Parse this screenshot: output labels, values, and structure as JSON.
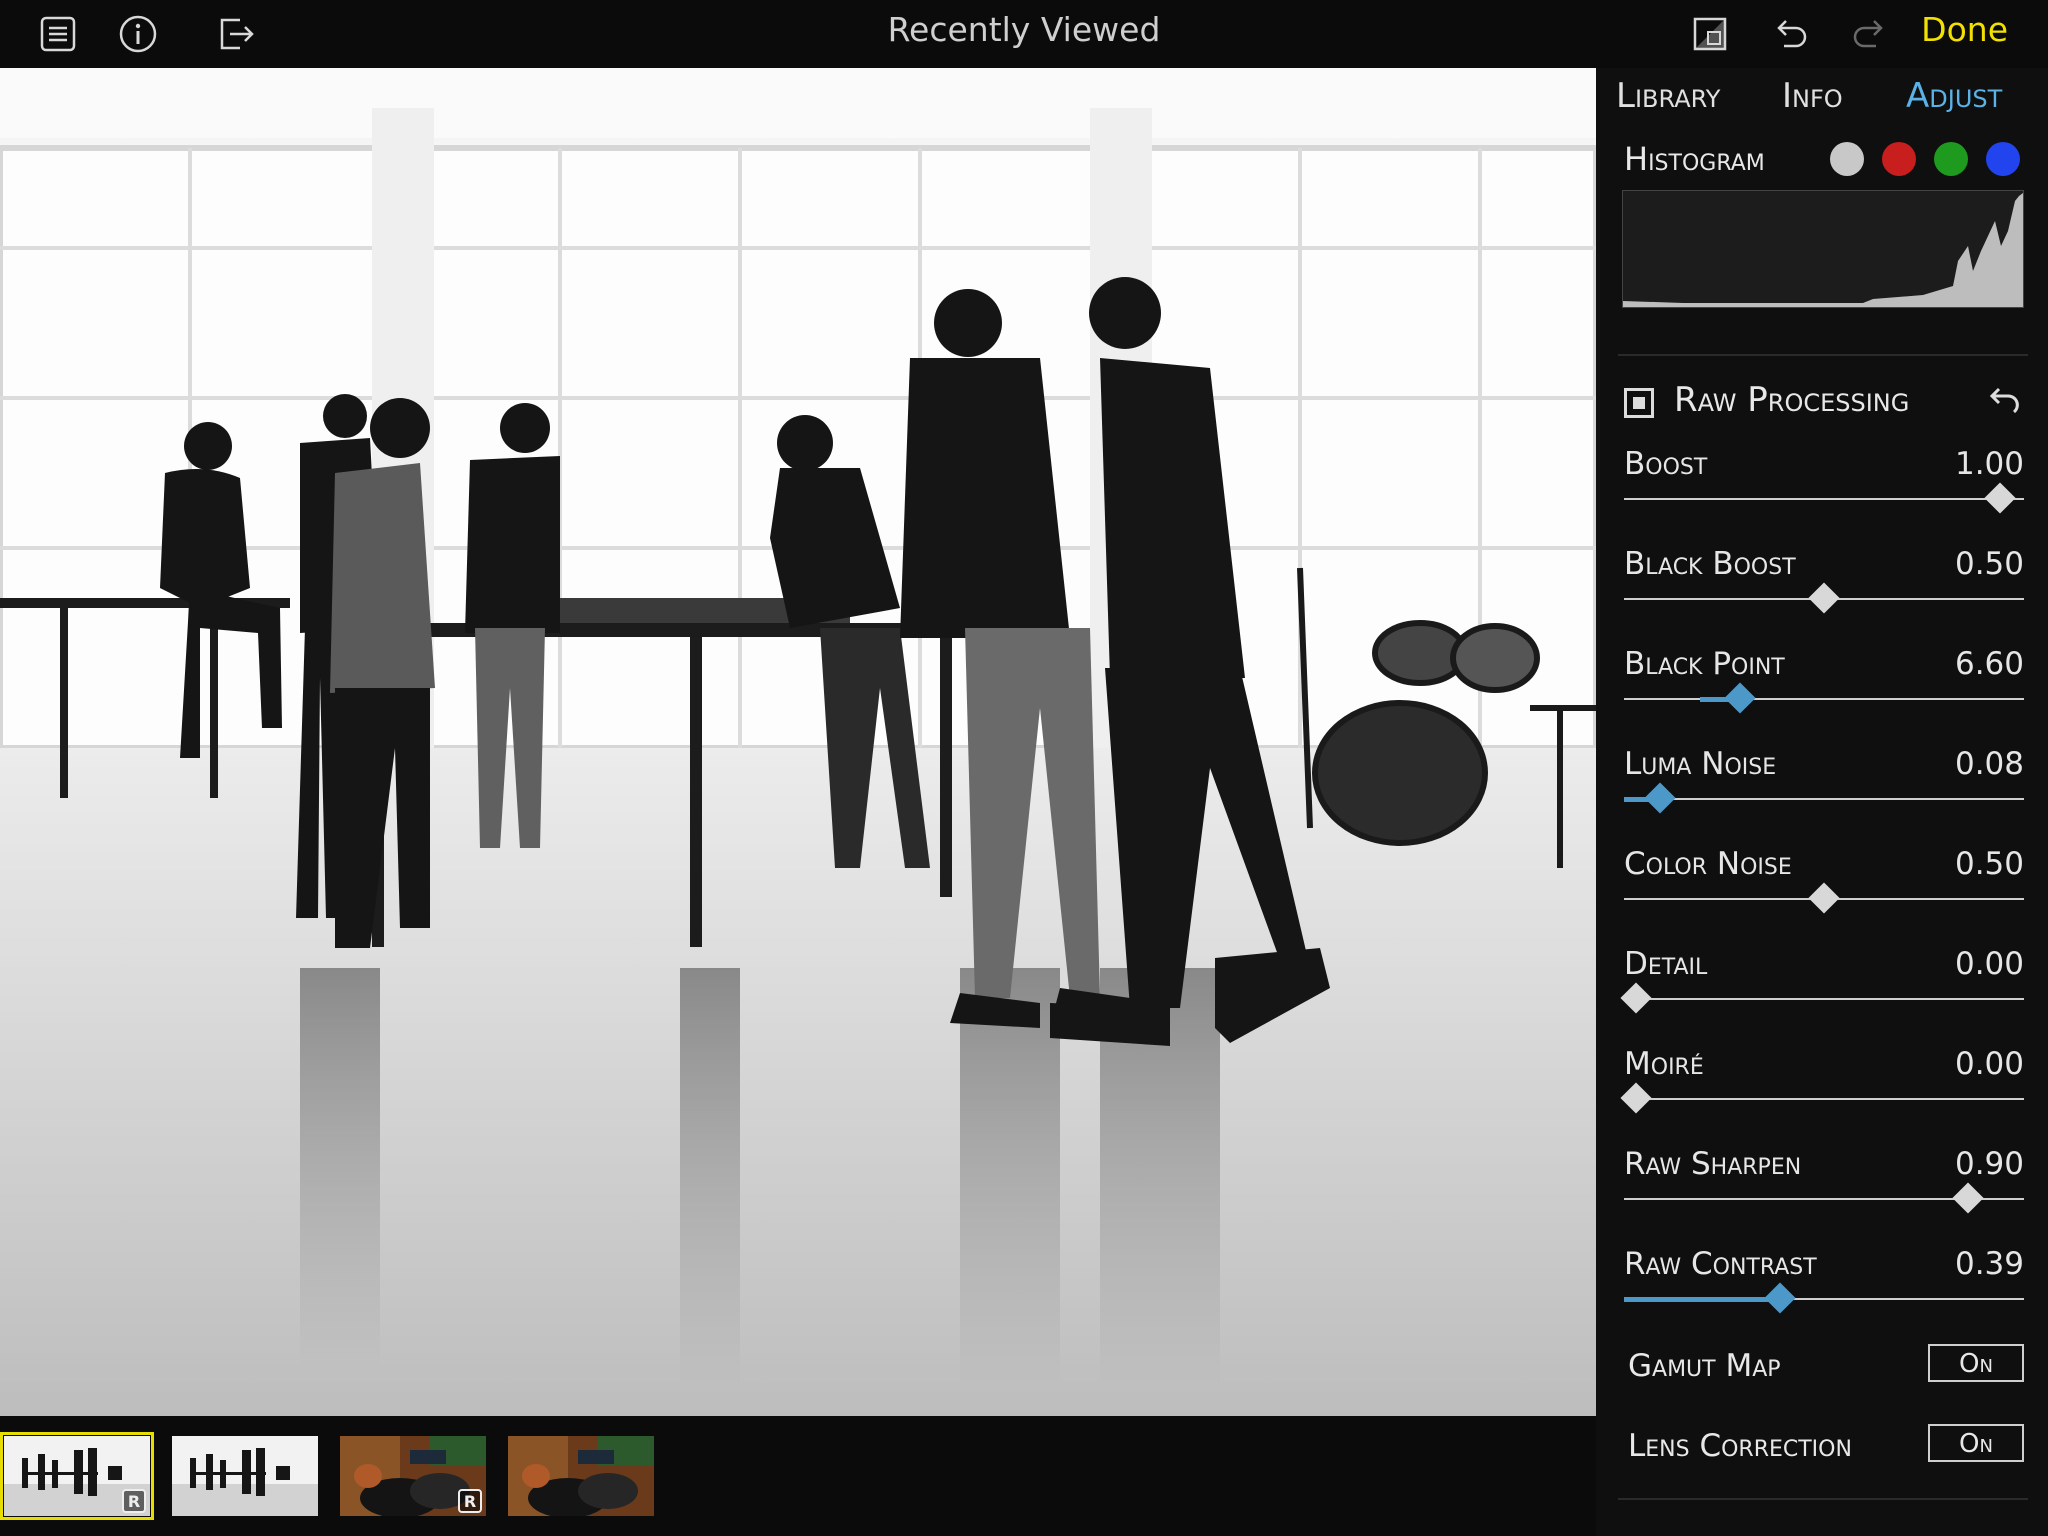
{
  "topbar": {
    "title": "Recently Viewed",
    "done_label": "Done",
    "icons": [
      "list-icon",
      "info-icon",
      "share-export-icon",
      "crop-compare-icon",
      "undo-icon",
      "redo-icon"
    ]
  },
  "panel": {
    "tabs": [
      {
        "label": "Library",
        "active": false
      },
      {
        "label": "Info",
        "active": false
      },
      {
        "label": "Adjust",
        "active": true
      }
    ],
    "histogram": {
      "label": "Histogram",
      "channels": [
        {
          "name": "luminance",
          "color": "#c8c8c8"
        },
        {
          "name": "red",
          "color": "#c81e1e"
        },
        {
          "name": "green",
          "color": "#1e9a1e"
        },
        {
          "name": "blue",
          "color": "#2244ee"
        }
      ]
    },
    "raw_processing": {
      "label": "Raw Processing",
      "enabled": true
    },
    "sliders": [
      {
        "label": "Boost",
        "value": "1.00",
        "fraction": 0.0,
        "thumb": 0.94,
        "fill": false
      },
      {
        "label": "Black Boost",
        "value": "0.50",
        "fraction": 0.0,
        "thumb": 0.5,
        "fill": false
      },
      {
        "label": "Black Point",
        "value": "6.60",
        "fraction": 0.0,
        "thumb": 0.29,
        "fill": true,
        "fill_from": 0.19
      },
      {
        "label": "Luma Noise",
        "value": "0.08",
        "fraction": 0.0,
        "thumb": 0.09,
        "fill": true,
        "fill_from": 0.0
      },
      {
        "label": "Color Noise",
        "value": "0.50",
        "fraction": 0.0,
        "thumb": 0.5,
        "fill": false
      },
      {
        "label": "Detail",
        "value": "0.00",
        "fraction": 0.0,
        "thumb": 0.03,
        "fill": false
      },
      {
        "label": "Moiré",
        "value": "0.00",
        "fraction": 0.0,
        "thumb": 0.03,
        "fill": false
      },
      {
        "label": "Raw Sharpen",
        "value": "0.90",
        "fraction": 0.0,
        "thumb": 0.86,
        "fill": false
      },
      {
        "label": "Raw Contrast",
        "value": "0.39",
        "fraction": 0.0,
        "thumb": 0.39,
        "fill": true,
        "fill_from": 0.0
      }
    ],
    "toggles": [
      {
        "label": "Gamut Map",
        "value": "On"
      },
      {
        "label": "Lens Correction",
        "value": "On"
      }
    ]
  },
  "filmstrip": {
    "items": [
      {
        "kind": "bw",
        "selected": true,
        "raw_badge": "R"
      },
      {
        "kind": "bw",
        "selected": false,
        "raw_badge": ""
      },
      {
        "kind": "color",
        "selected": false,
        "raw_badge": "R"
      },
      {
        "kind": "color",
        "selected": false,
        "raw_badge": ""
      }
    ]
  }
}
